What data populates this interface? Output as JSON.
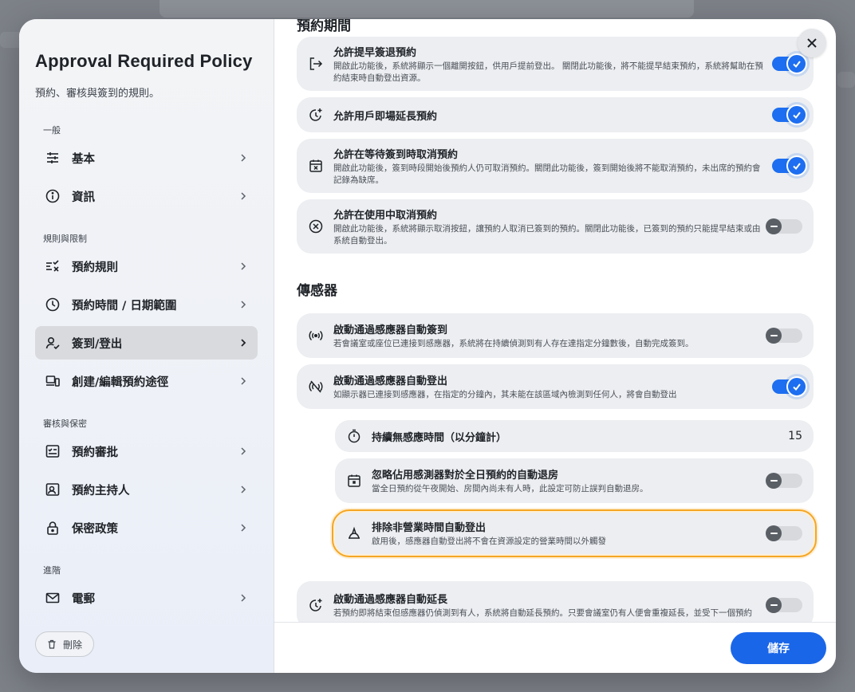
{
  "sidebar": {
    "title": "Approval Required Policy",
    "subtitle": "預約、審核與簽到的規則。",
    "groups": [
      {
        "label": "一般",
        "items": [
          {
            "label": "基本",
            "icon": "sliders-icon"
          },
          {
            "label": "資訊",
            "icon": "info-icon"
          }
        ]
      },
      {
        "label": "規則與限制",
        "items": [
          {
            "label": "預約規則",
            "icon": "list-check-icon"
          },
          {
            "label": "預約時間 / 日期範圍",
            "icon": "clock-icon"
          },
          {
            "label": "簽到/登出",
            "icon": "user-check-icon",
            "active": true
          },
          {
            "label": "創建/編輯預約途徑",
            "icon": "devices-icon"
          }
        ]
      },
      {
        "label": "審核與保密",
        "items": [
          {
            "label": "預約審批",
            "icon": "approval-icon"
          },
          {
            "label": "預約主持人",
            "icon": "host-icon"
          },
          {
            "label": "保密政策",
            "icon": "lock-icon"
          }
        ]
      },
      {
        "label": "進階",
        "items": [
          {
            "label": "電郵",
            "icon": "mail-icon"
          }
        ]
      }
    ],
    "delete_label": "刪除"
  },
  "main": {
    "top_section_heading": "預約期間",
    "cards": [
      {
        "title": "允許提早簽退預約",
        "desc": "開啟此功能後，系統將顯示一個離開按鈕，供用戶提前登出。 關閉此功能後，將不能提早結束預約，系統將幫助在預約結束時自動登出資源。",
        "on": true
      },
      {
        "title": "允許用戶即場延長預約",
        "desc": "",
        "on": true
      },
      {
        "title": "允許在等待簽到時取消預約",
        "desc": "開啟此功能後，簽到時段開始後預約人仍可取消預約。關閉此功能後，簽到開始後將不能取消預約，未出席的預約會記錄為缺席。",
        "on": true
      },
      {
        "title": "允許在使用中取消預約",
        "desc": "開啟此功能後，系統將顯示取消按鈕，讓預約人取消已簽到的預約。關閉此功能後，已簽到的預約只能提早結束或由系統自動登出。",
        "on": false
      }
    ],
    "sensor_heading": "傳感器",
    "sensor_cards": [
      {
        "title": "啟動通過感應器自動簽到",
        "desc": "若會議室或座位已連接到感應器，系統將在持續偵測到有人存在達指定分鐘數後，自動完成簽到。",
        "on": false
      },
      {
        "title": "啟動通過感應器自動登出",
        "desc": "如顯示器已連接到感應器，在指定的分鐘內，其未能在該區域內檢測到任何人，將會自動登出",
        "on": true
      }
    ],
    "sub_cards": {
      "duration_label": "持續無感應時間（以分鐘計）",
      "duration_value": "15",
      "ignore_title": "忽略佔用感測器對於全日預約的自動退房",
      "ignore_desc": "當全日預約從午夜開始、房間內尚未有人時，此設定可防止誤判自動退房。",
      "exclude_title": "排除非營業時間自動登出",
      "exclude_desc": "啟用後，感應器自動登出將不會在資源設定的營業時間以外觸發"
    },
    "extend_card": {
      "title": "啟動通過感應器自動延長",
      "desc": "若預約即將結束但感應器仍偵測到有人，系統將自動延長預約。只要會議室仍有人便會重複延長，並受下一個預約"
    },
    "save_label": "儲存"
  },
  "colors": {
    "accent": "#1d6ef0",
    "highlight": "#f5a623"
  }
}
